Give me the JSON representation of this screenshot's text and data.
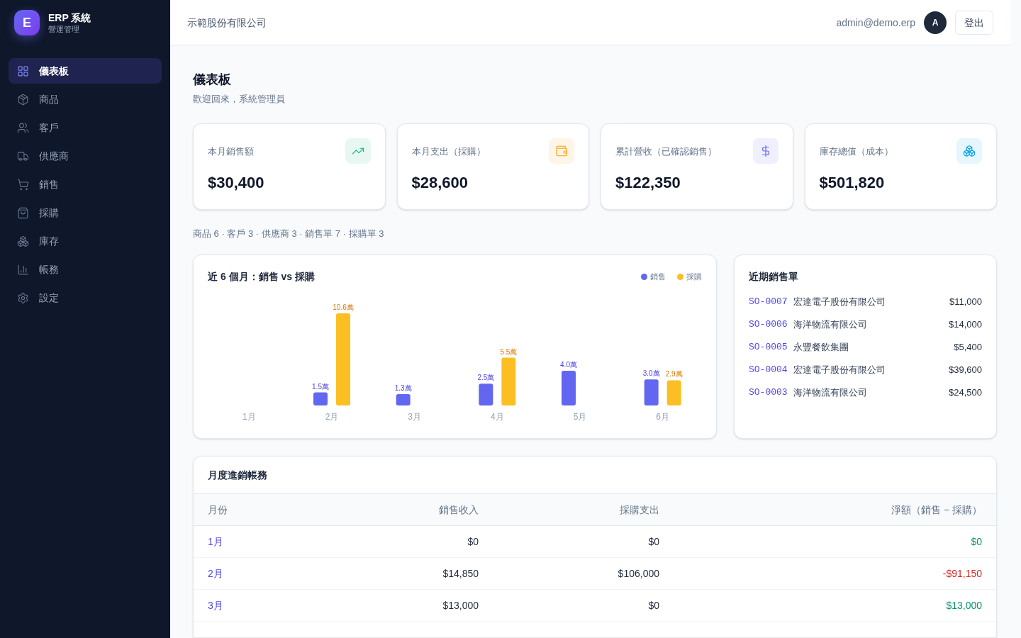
{
  "brand": {
    "logo": "E",
    "title": "ERP 系統",
    "subtitle": "營運管理"
  },
  "sidebar": {
    "items": [
      {
        "label": "儀表板",
        "selected": true
      },
      {
        "label": "商品",
        "selected": false
      },
      {
        "label": "客戶",
        "selected": false
      },
      {
        "label": "供應商",
        "selected": false
      },
      {
        "label": "銷售",
        "selected": false
      },
      {
        "label": "採購",
        "selected": false
      },
      {
        "label": "庫存",
        "selected": false
      },
      {
        "label": "帳務",
        "selected": false
      },
      {
        "label": "設定",
        "selected": false
      }
    ]
  },
  "header": {
    "company": "示範股份有限公司",
    "user": "admin@demo.erp",
    "avatar": "A",
    "logout": "登出"
  },
  "page": {
    "title": "儀表板",
    "subtitle": "歡迎回來，系統管理員"
  },
  "stats": [
    {
      "label": "本月銷售額",
      "value": "$30,400",
      "color": "#10b981"
    },
    {
      "label": "本月支出（採購）",
      "value": "$28,600",
      "color": "#f59e0b"
    },
    {
      "label": "累計營收（已確認銷售）",
      "value": "$122,350",
      "color": "#6366f1"
    },
    {
      "label": "庫存總值（成本）",
      "value": "$501,820",
      "color": "#0ea5e9"
    }
  ],
  "counts": "商品 6 · 客戶 3 · 供應商 3 · 銷售單 7 · 採購單 3",
  "chart": {
    "title": "近 6 個月：銷售 vs 採購",
    "chart_data": {
      "type": "bar",
      "categories": [
        "1月",
        "2月",
        "3月",
        "4月",
        "5月",
        "6月"
      ],
      "series": [
        {
          "name": "銷售",
          "color": "#6366f1",
          "values": [
            0,
            1.5,
            1.3,
            2.5,
            4.0,
            3.0
          ],
          "value_labels": [
            null,
            "1.5萬",
            "1.3萬",
            "2.5萬",
            "4.0萬",
            "3.0萬"
          ]
        },
        {
          "name": "採購",
          "color": "#fbbf24",
          "values": [
            0,
            10.6,
            0,
            5.5,
            0,
            2.9
          ],
          "value_labels": [
            null,
            "10.6萬",
            null,
            "5.5萬",
            null,
            "2.9萬"
          ]
        }
      ]
    }
  },
  "recent_sales": {
    "title": "近期銷售單",
    "rows": [
      {
        "id": "SO-0007",
        "customer": "宏達電子股份有限公司",
        "amount": "$11,000"
      },
      {
        "id": "SO-0006",
        "customer": "海洋物流有限公司",
        "amount": "$14,000"
      },
      {
        "id": "SO-0005",
        "customer": "永豐餐飲集團",
        "amount": "$5,400"
      },
      {
        "id": "SO-0004",
        "customer": "宏達電子股份有限公司",
        "amount": "$39,600"
      },
      {
        "id": "SO-0003",
        "customer": "海洋物流有限公司",
        "amount": "$24,500"
      }
    ]
  },
  "ledger": {
    "title": "月度進銷帳務",
    "columns": [
      "月份",
      "銷售收入",
      "採購支出",
      "淨額（銷售 − 採購）"
    ],
    "rows": [
      {
        "month": "1月",
        "sales": "$0",
        "purchase": "$0",
        "net": "$0",
        "color": "#059669"
      },
      {
        "month": "2月",
        "sales": "$14,850",
        "purchase": "$106,000",
        "net": "-$91,150",
        "color": "#dc2626"
      },
      {
        "month": "3月",
        "sales": "$13,000",
        "purchase": "$0",
        "net": "$13,000",
        "color": "#059669"
      }
    ]
  }
}
